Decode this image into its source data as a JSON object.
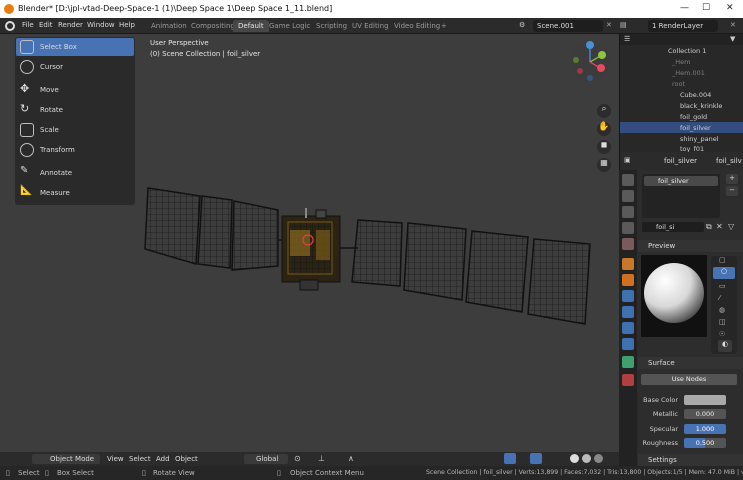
{
  "window": {
    "title": "Blender* [D:\\jpl-vtad-Deep-Space-1 (1)\\Deep Space 1\\Deep Space 1_11.blend]",
    "minimize": "—",
    "maximize": "☐",
    "close": "✕"
  },
  "menu": [
    "File",
    "Edit",
    "Render",
    "Window",
    "Help"
  ],
  "workspaces": [
    "Animation",
    "Compositing",
    "Default",
    "Game Logic",
    "Scripting",
    "UV Editing",
    "Video Editing",
    "+"
  ],
  "active_workspace": "Default",
  "scene": "Scene.001",
  "render_layer": "1 RenderLayer",
  "viewport": {
    "perspective": "User Perspective",
    "collection_info": "(0) Scene Collection | foil_silver"
  },
  "tools": [
    "Select Box",
    "Cursor",
    "Move",
    "Rotate",
    "Scale",
    "Transform",
    "Annotate",
    "Measure"
  ],
  "viewport_header": {
    "mode": "Object Mode",
    "menus": [
      "View",
      "Select",
      "Add",
      "Object"
    ],
    "orientation": "Global"
  },
  "status": {
    "select": "Select",
    "box_select": "Box Select",
    "rotate_view": "Rotate View",
    "context_menu": "Object Context Menu",
    "stats": "Scene Collection | foil_silver | Verts:13,899 | Faces:7,032 | Tris:13,800 | Objects:1/5 | Mem: 47.0 MiB | v2.82.7"
  },
  "outliner": {
    "items": [
      {
        "label": "Collection 1",
        "state": "normal"
      },
      {
        "label": "_Hem",
        "state": "dim"
      },
      {
        "label": "_Hem.001",
        "state": "dim"
      },
      {
        "label": "root",
        "state": "dim"
      },
      {
        "label": "Cube.004",
        "state": "normal"
      },
      {
        "label": "black_krinkle",
        "state": "normal"
      },
      {
        "label": "foil_gold",
        "state": "normal"
      },
      {
        "label": "foil_silver",
        "state": "selected"
      },
      {
        "label": "shiny_panel",
        "state": "normal"
      },
      {
        "label": "toy_f01",
        "state": "normal"
      }
    ]
  },
  "properties": {
    "header_object": "foil_silver",
    "header_material": "foil_silv",
    "slot_name": "foil_silver",
    "material_field": "foil_si",
    "preview_section": "Preview",
    "surface_section": "Surface",
    "use_nodes_label": "Use Nodes",
    "fields": [
      {
        "label": "Base Color",
        "value": ""
      },
      {
        "label": "Metallic",
        "value": "0.000"
      },
      {
        "label": "Specular",
        "value": "1.000"
      },
      {
        "label": "Roughness",
        "value": "0.500"
      }
    ],
    "settings_section": "Settings"
  },
  "colors": {
    "accent": "#4772b3",
    "viewport": "#3d3d3d",
    "gizmo_x": "#e84a5f",
    "gizmo_y": "#8ec63f",
    "gizmo_z": "#4a90d9"
  }
}
